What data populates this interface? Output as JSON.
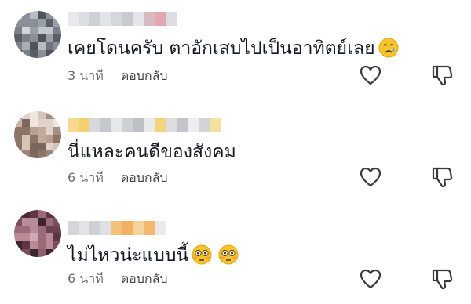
{
  "comments": [
    {
      "text": "เคยโดนครับ ตาอักเสบไปเป็นอาทิตย์เลย",
      "emoji": "crying-face",
      "time": "3 นาที",
      "reply_label": "ตอบกลับ"
    },
    {
      "text": "นี่แหละคนดีของสังคม",
      "time": "6 นาที",
      "reply_label": "ตอบกลับ"
    },
    {
      "text": "ไม่ไหวน่ะแบบนี้",
      "emoji": "flushed-face",
      "time": "6 นาที",
      "reply_label": "ตอบกลับ"
    }
  ],
  "icons": {
    "like": "heart-outline-icon",
    "dislike": "thumbs-down-outline-icon"
  },
  "colors": {
    "text": "#161823",
    "secondary_text": "#6e6e6e",
    "icon": "#3a3a3a"
  }
}
